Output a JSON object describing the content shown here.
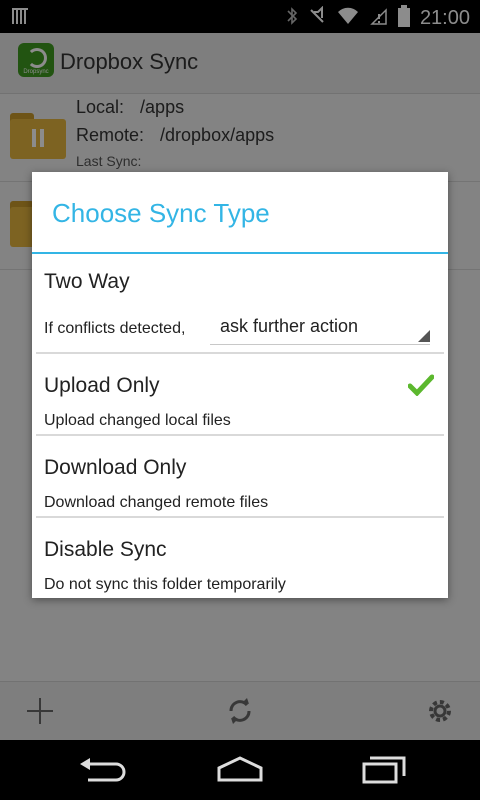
{
  "status_bar": {
    "time": "21:00",
    "icons": [
      "signal-bars-icon",
      "bluetooth-icon",
      "muted-icon",
      "wifi-icon",
      "no-signal-icon",
      "battery-icon"
    ]
  },
  "app": {
    "title": "Dropbox Sync",
    "logo_caption": "Dropsync",
    "folders": [
      {
        "local_label": "Local:",
        "local_value": "/apps",
        "remote_label": "Remote:",
        "remote_value": "/dropbox/apps",
        "last_sync_label": "Last Sync:",
        "state": "paused"
      }
    ],
    "bottom_bar": {
      "icons": [
        "add-icon",
        "sync-icon",
        "settings-icon"
      ]
    }
  },
  "dialog": {
    "title": "Choose Sync Type",
    "options": [
      {
        "title": "Two Way",
        "conflict_label": "If conflicts detected,",
        "conflict_value": "ask further action",
        "selected": false
      },
      {
        "title": "Upload Only",
        "desc": "Upload changed local files",
        "selected": true
      },
      {
        "title": "Download Only",
        "desc": "Download changed remote files",
        "selected": false
      },
      {
        "title": "Disable Sync",
        "desc": "Do not sync this folder temporarily",
        "selected": false
      }
    ]
  },
  "colors": {
    "accent": "#33b5e5",
    "check": "#5cb82e"
  }
}
